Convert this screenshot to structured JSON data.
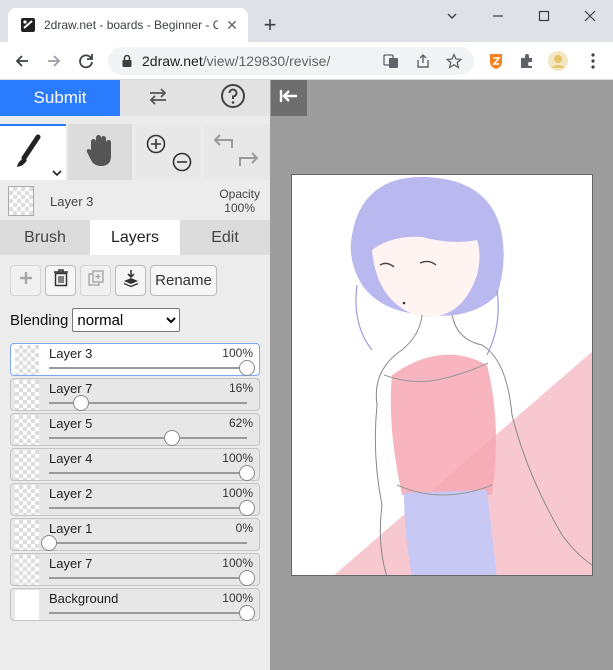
{
  "browser": {
    "tab_title": "2draw.net - boards - Beginner - C",
    "tab_close": "✕",
    "new_tab": "+",
    "url_host": "2draw.net",
    "url_path": "/view/129830/revise/"
  },
  "app": {
    "submit_label": "Submit",
    "current_layer": "Layer 3",
    "opacity_label": "Opacity",
    "opacity_value": "100%",
    "tabs": [
      "Brush",
      "Layers",
      "Edit"
    ],
    "rename_label": "Rename",
    "blending_label": "Blending",
    "blending_value": "normal",
    "layers": [
      {
        "name": "Layer 3",
        "percent": "100%",
        "value": 1.0,
        "selected": true
      },
      {
        "name": "Layer 7",
        "percent": "16%",
        "value": 0.16,
        "selected": false
      },
      {
        "name": "Layer 5",
        "percent": "62%",
        "value": 0.62,
        "selected": false
      },
      {
        "name": "Layer 4",
        "percent": "100%",
        "value": 1.0,
        "selected": false
      },
      {
        "name": "Layer 2",
        "percent": "100%",
        "value": 1.0,
        "selected": false
      },
      {
        "name": "Layer 1",
        "percent": "0%",
        "value": 0.0,
        "selected": false
      },
      {
        "name": "Layer 7",
        "percent": "100%",
        "value": 1.0,
        "selected": false
      },
      {
        "name": "Background",
        "percent": "100%",
        "value": 1.0,
        "selected": false
      }
    ]
  },
  "colors": {
    "accent": "#2b7bff",
    "canvas_bg": "#9d9d9d",
    "hair": "#b9b8ef",
    "top": "#f7a8b4",
    "stripe": "#f8c8d0",
    "pants": "#c8c8f5"
  }
}
